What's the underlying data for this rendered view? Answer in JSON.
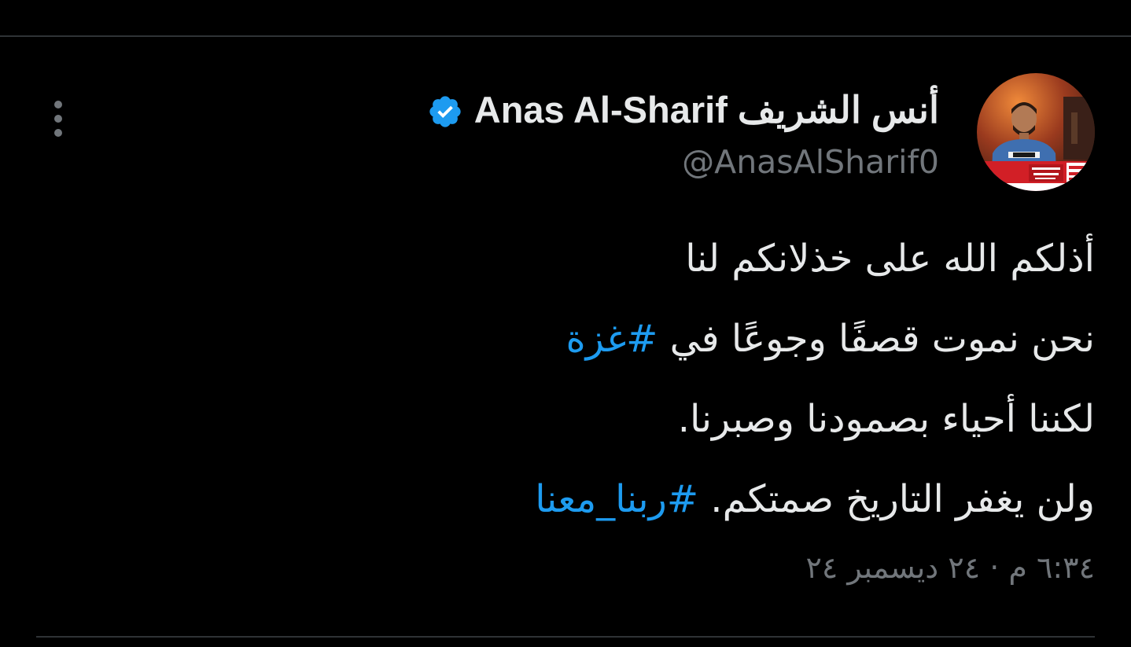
{
  "colors": {
    "background": "#000000",
    "primary_text": "#e7e9ea",
    "secondary_text": "#71767b",
    "accent": "#1d9bf0",
    "divider": "#2f3336"
  },
  "more_menu": {
    "icon": "more-vertical-icon"
  },
  "author": {
    "display_name": "Anas Al-Sharif أنس الشريف",
    "verified_icon": "verified-badge-icon",
    "handle": "@AnasAlSharif0",
    "avatar_icon": "profile-photo"
  },
  "tweet": {
    "line1": "أذلكم الله على خذلانكم لنا",
    "line2_text": "نحن نموت قصفًا وجوعًا في ",
    "line2_hashtag": "#غزة",
    "line3": "لكننا أحياء بصمودنا وصبرنا.",
    "line4_text": "ولن يغفر التاريخ صمتكم. ",
    "line4_hashtag": "#ربنا_معنا"
  },
  "timestamp": "٦:٣٤ م · ٢٤ ديسمبر ٢٤"
}
